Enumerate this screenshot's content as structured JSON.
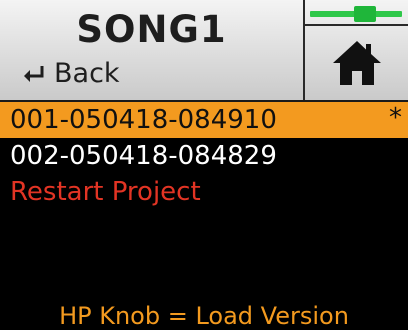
{
  "header": {
    "title": "SONG1",
    "back_label": "Back",
    "back_icon": "return-arrow-icon",
    "home_icon": "home-icon",
    "meter_icon": "level-meter-icon",
    "meter_level": 0.6
  },
  "versions": [
    {
      "label": "001-050418-084910",
      "marker": "*",
      "selected": true
    },
    {
      "label": "002-050418-084829",
      "marker": "",
      "selected": false
    }
  ],
  "restart_label": "Restart Project",
  "footer_hint": "HP Knob = Load Version",
  "colors": {
    "accent": "#f39a1f",
    "restart": "#e23424",
    "meter": "#2fc84a",
    "background": "#000000"
  }
}
